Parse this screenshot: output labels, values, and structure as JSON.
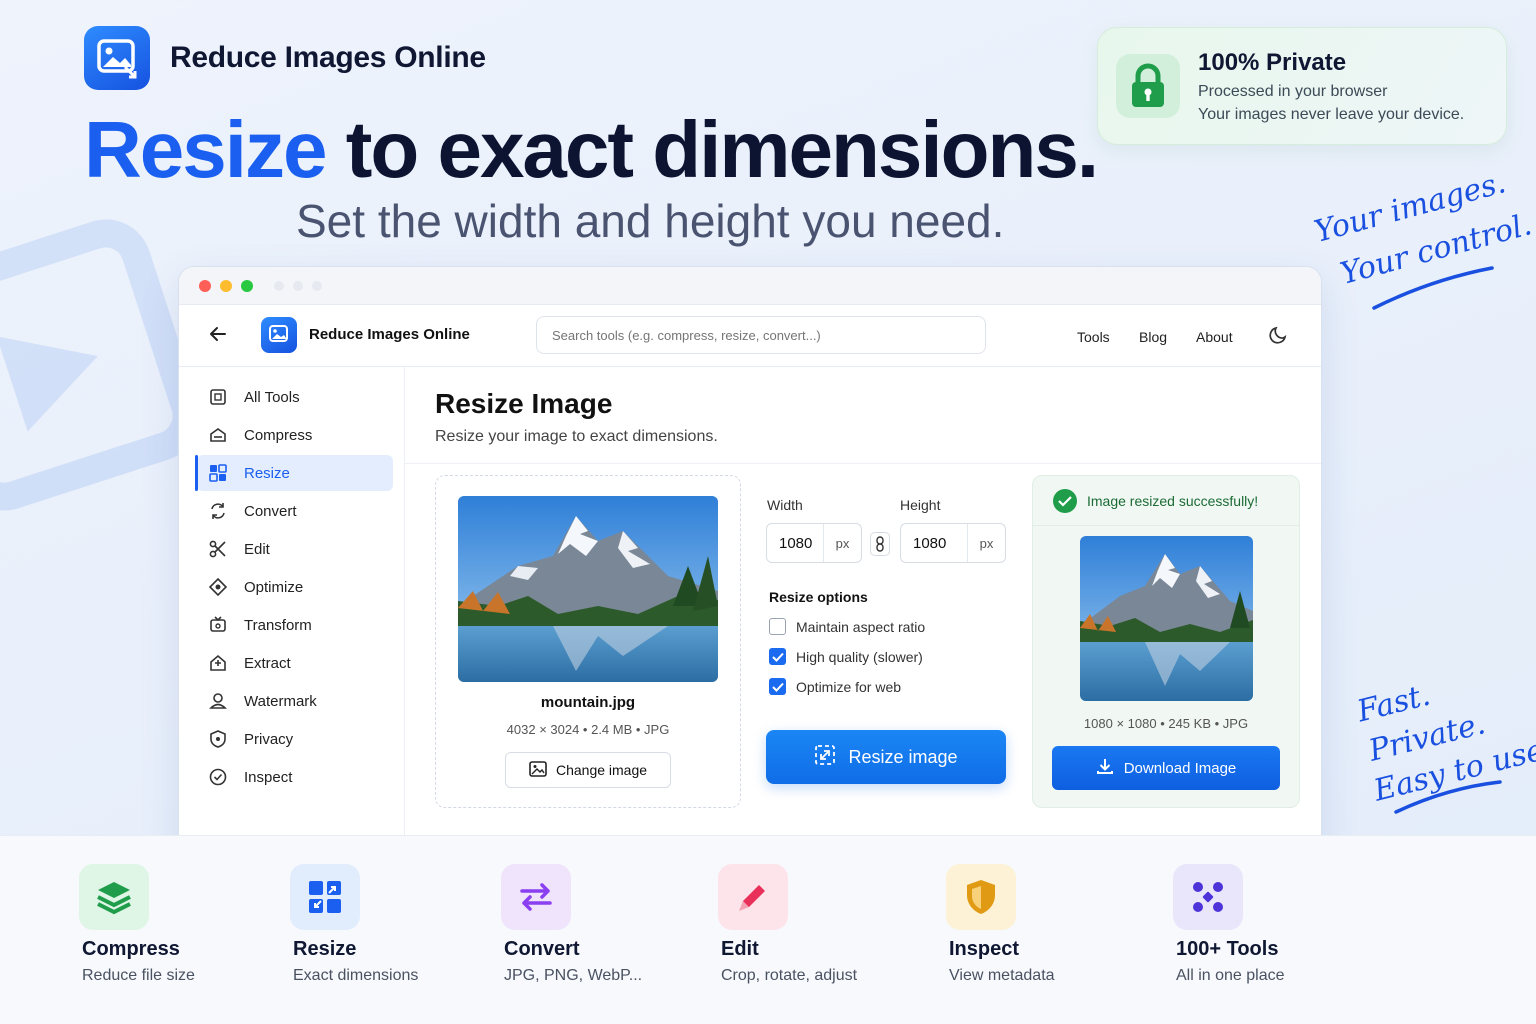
{
  "brand": {
    "name": "Reduce Images Online"
  },
  "hero": {
    "title_accent": "Resize",
    "title_rest": " to exact dimensions.",
    "subtitle": "Set the width and height you need."
  },
  "private_card": {
    "title": "100% Private",
    "line1": "Processed in your browser",
    "line2": "Your images never leave your device."
  },
  "handwritten": {
    "top_line1": "Your images.",
    "top_line2": "Your control.",
    "bottom_line1": "Fast.",
    "bottom_line2": "Private.",
    "bottom_line3": "Easy to use."
  },
  "app": {
    "name": "Reduce Images Online",
    "search_placeholder": "Search tools (e.g. compress, resize, convert...)",
    "nav": [
      "Tools",
      "Blog",
      "About"
    ]
  },
  "sidebar": {
    "items": [
      {
        "label": "All Tools",
        "icon": "grid-icon"
      },
      {
        "label": "Compress",
        "icon": "compress-icon"
      },
      {
        "label": "Resize",
        "icon": "resize-icon",
        "active": true
      },
      {
        "label": "Convert",
        "icon": "convert-icon"
      },
      {
        "label": "Edit",
        "icon": "scissors-icon"
      },
      {
        "label": "Optimize",
        "icon": "optimize-icon"
      },
      {
        "label": "Transform",
        "icon": "transform-icon"
      },
      {
        "label": "Extract",
        "icon": "extract-icon"
      },
      {
        "label": "Watermark",
        "icon": "watermark-icon"
      },
      {
        "label": "Privacy",
        "icon": "shield-icon"
      },
      {
        "label": "Inspect",
        "icon": "inspect-icon"
      }
    ]
  },
  "main": {
    "title": "Resize Image",
    "subtitle": "Resize your image to exact dimensions.",
    "original": {
      "name": "mountain.jpg",
      "meta": "4032 × 3024  •  2.4 MB  •  JPG",
      "change_label": "Change image"
    },
    "width_label": "Width",
    "height_label": "Height",
    "width_value": "1080",
    "height_value": "1080",
    "unit": "px",
    "options_title": "Resize options",
    "options": [
      {
        "label": "Maintain aspect ratio",
        "checked": false
      },
      {
        "label": "High quality (slower)",
        "checked": true
      },
      {
        "label": "Optimize for web",
        "checked": true
      }
    ],
    "resize_label": "Resize image",
    "result": {
      "status": "Image resized successfully!",
      "meta": "1080 × 1080  •  245 KB  •  JPG",
      "download_label": "Download Image"
    }
  },
  "features": [
    {
      "title": "Compress",
      "sub": "Reduce file size",
      "icon": "layers-icon",
      "bg": "#dff5e6",
      "color": "#1f9d4b"
    },
    {
      "title": "Resize",
      "sub": "Exact dimensions",
      "icon": "resize-icon",
      "bg": "#e1ecfd",
      "color": "#1a5ff0"
    },
    {
      "title": "Convert",
      "sub": "JPG, PNG, WebP...",
      "icon": "convert-icon",
      "bg": "#efe4fc",
      "color": "#8a3ff0"
    },
    {
      "title": "Edit",
      "sub": "Crop, rotate, adjust",
      "icon": "pencil-icon",
      "bg": "#fde4ea",
      "color": "#e8305a"
    },
    {
      "title": "Inspect",
      "sub": "View metadata",
      "icon": "shield-icon",
      "bg": "#fdf1d6",
      "color": "#e19a13"
    },
    {
      "title": "100+ Tools",
      "sub": "All in one place",
      "icon": "tools-icon",
      "bg": "#e9e6fc",
      "color": "#4d34d8"
    }
  ]
}
